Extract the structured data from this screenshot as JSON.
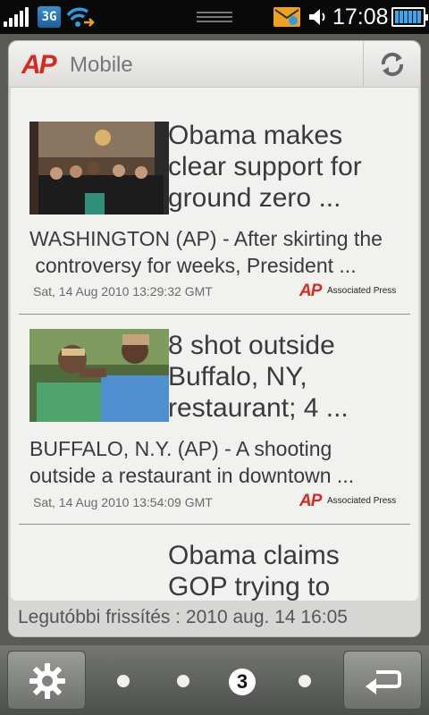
{
  "status_bar": {
    "network": "3G",
    "time": "17:08",
    "icons": [
      "signal-icon",
      "network-3g-icon",
      "wifi-icon",
      "handle-icon",
      "mail-icon",
      "speaker-icon",
      "battery-icon"
    ]
  },
  "widget": {
    "logo_ap": "AP",
    "logo_text": "Mobile",
    "refresh_icon": "refresh-icon"
  },
  "news": [
    {
      "title_lines": [
        "Obama makes",
        "clear support for",
        "ground zero ..."
      ],
      "summary_lines": [
        "WASHINGTON (AP) - After skirting the",
        " controversy for weeks, President ..."
      ],
      "date": "Sat, 14 Aug 2010 13:29:32 GMT",
      "source_ap": "AP",
      "source": "Associated Press"
    },
    {
      "title_lines": [
        "8 shot outside",
        "Buffalo, NY,",
        "restaurant; 4 ..."
      ],
      "summary_lines": [
        "BUFFALO, N.Y. (AP) - A shooting",
        "outside a restaurant in downtown ..."
      ],
      "date": "Sat, 14 Aug 2010 13:54:09 GMT",
      "source_ap": "AP",
      "source": "Associated Press"
    },
    {
      "title_lines": [
        "Obama claims",
        "GOP trying to"
      ]
    }
  ],
  "footer": {
    "last_update": "Legutóbbi frissítés : 2010 aug. 14 16:05"
  },
  "bottom_bar": {
    "current_page": "3",
    "settings_icon": "gear-icon",
    "back_icon": "back-arrow-icon"
  },
  "colors": {
    "ap_red": "#d52b1e",
    "status_bar": "#0a0a0a",
    "mail_orange": "#f0a21f",
    "battery_blue": "#39a7f0"
  }
}
